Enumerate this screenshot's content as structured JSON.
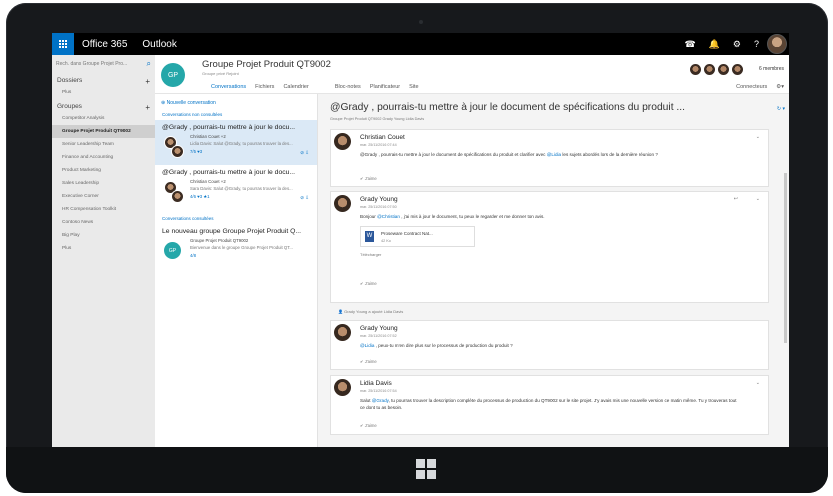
{
  "app": {
    "brand": "Office 365",
    "name": "Outlook"
  },
  "topbar": {
    "icons": [
      "☎",
      "🔔",
      "⚙",
      "?"
    ]
  },
  "leftpane": {
    "search_placeholder": "Rech. dans Groupe Projet Pro...",
    "folders_header": "Dossiers",
    "folders_more": "Plus",
    "groups_header": "Groupes",
    "groups": [
      "Competitor Analysis",
      "Groupe Projet Produit QT9002",
      "Senior Leadership Team",
      "Finance and Accounting",
      "Product Marketing",
      "Sales Leadership",
      "Executive Corner",
      "HR Compensation Toolkit",
      "Contoso News",
      "Big Play",
      "Plus"
    ]
  },
  "group": {
    "avatar_initials": "GP",
    "title": "Groupe Projet Produit QT9002",
    "subtitle": "Groupe privé  Rejoint",
    "member_count": "6 membres"
  },
  "tabs": {
    "conversations": "Conversations",
    "files": "Fichiers",
    "calendar": "Calendrier",
    "notebook": "Bloc-notes",
    "planner": "Planificateur",
    "site": "Site",
    "connectors": "Connecteurs"
  },
  "convlist": {
    "new_conversation": "Nouvelle conversation",
    "section_unread": "Conversations non consultées",
    "section_read": "Conversations consultées",
    "items": [
      {
        "title": "@Grady , pourrais-tu mettre à jour le docu...",
        "from": "Christian Couet +2",
        "preview": "Lidia Davis: Salut @Grady, tu pourras trouver la des...",
        "meta": "7/5  ♥3"
      },
      {
        "title": "@Grady , pourrais-tu mettre à jour le docu...",
        "from": "Christian Couet +2",
        "preview": "Sara Davis: Salut @Grady, tu pourras trouver la des...",
        "meta": "4/6  ♥3  ★1"
      },
      {
        "title": "Le nouveau groupe Groupe Projet Produit Q...",
        "from": "Groupe Projet Produit QT9002",
        "preview": "Bienvenue dans le groupe Groupe Projet Produit QT...",
        "meta": "4/8"
      }
    ]
  },
  "reading": {
    "title": "@Grady , pourrais-tu mettre à jour le document de spécifications du produit ...",
    "members": "Groupe Projet Produit QT9002  Grady Young  Lidia Davis",
    "messages": [
      {
        "sender": "Christian Couet",
        "date": "mar. 25/11/2016 07:44",
        "body_pre": "@Grady , pourrais-tu mettre à jour le document de spécifications du produit et clarifier avec ",
        "mention": "@Lidia",
        "body_post": " les sujets abordés lors de la dernière réunion ?",
        "like": "J'aime"
      },
      {
        "sender": "Grady Young",
        "date": "mar. 25/11/2016 07:50",
        "body_pre": "Bonjour ",
        "mention": "@Christian",
        "body_post": " , j'ai mis à jour le document, tu peux le regarder et me donner ton avis.",
        "like": "J'aime",
        "attachment": "Proseware Contract Nat...",
        "attachment_size": "42 Ko",
        "download": "Télécharger"
      },
      {
        "sender": "Grady Young",
        "date": "mar. 25/11/2016 07:52",
        "body_pre": "",
        "mention": "@Lidia",
        "body_post": " , peux-tu m'en dire plus sur le processus de production du produit ?",
        "like": "J'aime"
      },
      {
        "sender": "Lidia Davis",
        "date": "mar. 25/11/2016 07:54",
        "body_pre": "Salut ",
        "mention": "@Grady",
        "body_post": ", tu pourras trouver la description complète du processus de production du QT9002 sur le site projet. J'y avais mis une nouvelle version ce matin même. Tu y trouveras tout ce dont tu as besoin.",
        "like": "J'aime"
      }
    ],
    "added_info": "Grady Young a ajouté Lidia Davis"
  }
}
